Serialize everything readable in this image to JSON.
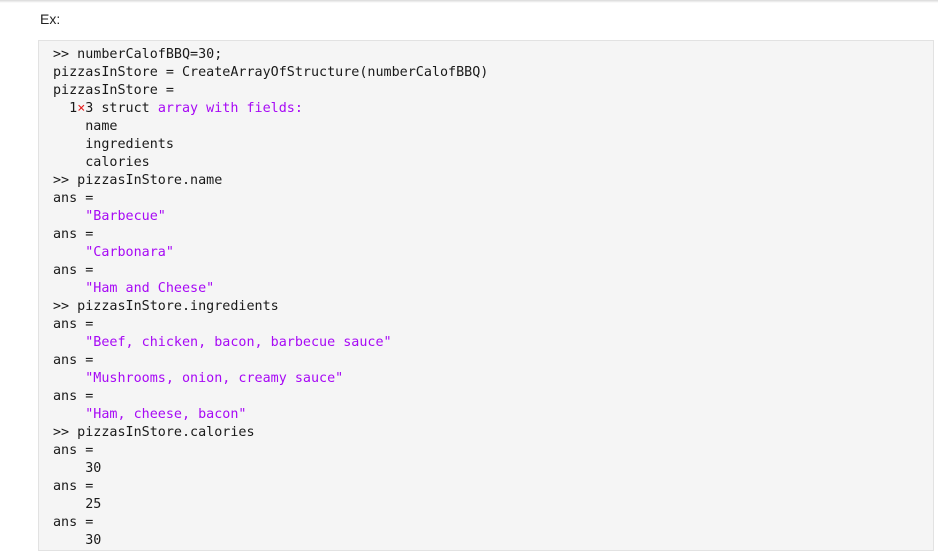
{
  "label": "Ex:",
  "colors": {
    "string": "#a709f5",
    "times_symbol": "#e51c1c",
    "text": "#1a1a1a",
    "code_background": "#f5f5f5"
  },
  "lines": [
    {
      "indent": "",
      "text": ">> numberCalofBBQ=30;"
    },
    {
      "indent": "",
      "text": "pizzasInStore = CreateArrayOfStructure(numberCalofBBQ)"
    },
    {
      "indent": "",
      "text": "pizzasInStore ="
    },
    {
      "indent": "  ",
      "struct_rows": "1",
      "times": "×",
      "struct_cols": "3",
      "struct_word": " struct ",
      "highlight": "array with fields:"
    },
    {
      "indent": "    ",
      "text": "name"
    },
    {
      "indent": "    ",
      "text": "ingredients"
    },
    {
      "indent": "    ",
      "text": "calories"
    },
    {
      "indent": "",
      "text": ">> pizzasInStore.name"
    },
    {
      "indent": "",
      "text": "ans ="
    },
    {
      "indent": "    ",
      "string": "\"Barbecue\""
    },
    {
      "indent": "",
      "text": "ans ="
    },
    {
      "indent": "    ",
      "string": "\"Carbonara\""
    },
    {
      "indent": "",
      "text": "ans ="
    },
    {
      "indent": "    ",
      "string": "\"Ham and Cheese\""
    },
    {
      "indent": "",
      "text": ">> pizzasInStore.ingredients"
    },
    {
      "indent": "",
      "text": "ans ="
    },
    {
      "indent": "    ",
      "string": "\"Beef, chicken, bacon, barbecue sauce\""
    },
    {
      "indent": "",
      "text": "ans ="
    },
    {
      "indent": "    ",
      "string": "\"Mushrooms, onion, creamy sauce\""
    },
    {
      "indent": "",
      "text": "ans ="
    },
    {
      "indent": "    ",
      "string": "\"Ham, cheese, bacon\""
    },
    {
      "indent": "",
      "text": ">> pizzasInStore.calories"
    },
    {
      "indent": "",
      "text": "ans ="
    },
    {
      "indent": "    ",
      "text": "30"
    },
    {
      "indent": "",
      "text": "ans ="
    },
    {
      "indent": "    ",
      "text": "25"
    },
    {
      "indent": "",
      "text": "ans ="
    },
    {
      "indent": "    ",
      "text": "30"
    }
  ]
}
